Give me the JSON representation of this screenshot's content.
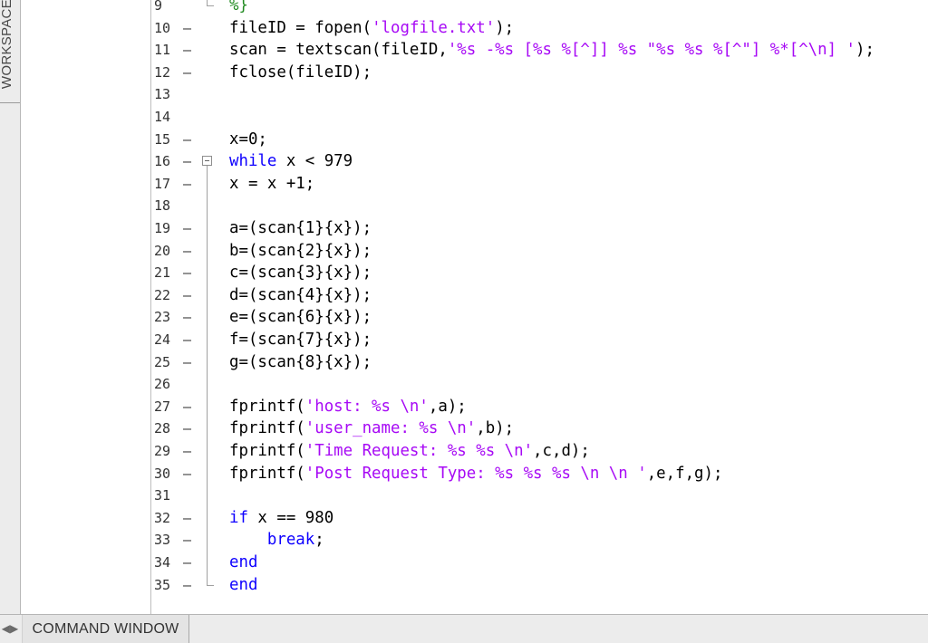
{
  "workspace": {
    "label": "WORKSPACE"
  },
  "command_window": {
    "label": "COMMAND WINDOW",
    "toggle_glyph": "◀▶"
  },
  "editor": {
    "lines": [
      {
        "n": "9",
        "dash": "",
        "segs": [
          {
            "t": "%}",
            "c": "cm"
          }
        ]
      },
      {
        "n": "10",
        "dash": "–",
        "segs": [
          {
            "t": "fileID = fopen(",
            "c": ""
          },
          {
            "t": "'logfile.txt'",
            "c": "str"
          },
          {
            "t": ");",
            "c": ""
          }
        ]
      },
      {
        "n": "11",
        "dash": "–",
        "segs": [
          {
            "t": "scan = textscan(fileID,",
            "c": ""
          },
          {
            "t": "'%s -%s [%s %[^]] %s \"%s %s %[^\"] %*[^\\n] '",
            "c": "str"
          },
          {
            "t": ");",
            "c": ""
          }
        ]
      },
      {
        "n": "12",
        "dash": "–",
        "segs": [
          {
            "t": "fclose(fileID);",
            "c": ""
          }
        ]
      },
      {
        "n": "13",
        "dash": "",
        "segs": []
      },
      {
        "n": "14",
        "dash": "",
        "segs": []
      },
      {
        "n": "15",
        "dash": "–",
        "segs": [
          {
            "t": "x=0;",
            "c": ""
          }
        ]
      },
      {
        "n": "16",
        "dash": "–",
        "segs": [
          {
            "t": "while",
            "c": "kw"
          },
          {
            "t": " x < 979",
            "c": ""
          }
        ]
      },
      {
        "n": "17",
        "dash": "–",
        "segs": [
          {
            "t": "x = x +1;",
            "c": ""
          }
        ]
      },
      {
        "n": "18",
        "dash": "",
        "segs": []
      },
      {
        "n": "19",
        "dash": "–",
        "segs": [
          {
            "t": "a=(scan{1}{x});",
            "c": ""
          }
        ]
      },
      {
        "n": "20",
        "dash": "–",
        "segs": [
          {
            "t": "b=(scan{2}{x});",
            "c": ""
          }
        ]
      },
      {
        "n": "21",
        "dash": "–",
        "segs": [
          {
            "t": "c=(scan{3}{x});",
            "c": ""
          }
        ]
      },
      {
        "n": "22",
        "dash": "–",
        "segs": [
          {
            "t": "d=(scan{4}{x});",
            "c": ""
          }
        ]
      },
      {
        "n": "23",
        "dash": "–",
        "segs": [
          {
            "t": "e=(scan{6}{x});",
            "c": ""
          }
        ]
      },
      {
        "n": "24",
        "dash": "–",
        "segs": [
          {
            "t": "f=(scan{7}{x});",
            "c": ""
          }
        ]
      },
      {
        "n": "25",
        "dash": "–",
        "segs": [
          {
            "t": "g=(scan{8}{x});",
            "c": ""
          }
        ]
      },
      {
        "n": "26",
        "dash": "",
        "segs": []
      },
      {
        "n": "27",
        "dash": "–",
        "segs": [
          {
            "t": "fprintf(",
            "c": ""
          },
          {
            "t": "'host: %s \\n'",
            "c": "str"
          },
          {
            "t": ",a);",
            "c": ""
          }
        ]
      },
      {
        "n": "28",
        "dash": "–",
        "segs": [
          {
            "t": "fprintf(",
            "c": ""
          },
          {
            "t": "'user_name: %s \\n'",
            "c": "str"
          },
          {
            "t": ",b);",
            "c": ""
          }
        ]
      },
      {
        "n": "29",
        "dash": "–",
        "segs": [
          {
            "t": "fprintf(",
            "c": ""
          },
          {
            "t": "'Time Request: %s %s \\n'",
            "c": "str"
          },
          {
            "t": ",c,d);",
            "c": ""
          }
        ]
      },
      {
        "n": "30",
        "dash": "–",
        "segs": [
          {
            "t": "fprintf(",
            "c": ""
          },
          {
            "t": "'Post Request Type: %s %s %s \\n \\n '",
            "c": "str"
          },
          {
            "t": ",e,f,g);",
            "c": ""
          }
        ]
      },
      {
        "n": "31",
        "dash": "",
        "segs": []
      },
      {
        "n": "32",
        "dash": "–",
        "segs": [
          {
            "t": "if",
            "c": "kw"
          },
          {
            "t": " x == 980",
            "c": ""
          }
        ]
      },
      {
        "n": "33",
        "dash": "–",
        "segs": [
          {
            "t": "    ",
            "c": ""
          },
          {
            "t": "break",
            "c": "kw"
          },
          {
            "t": ";",
            "c": ""
          }
        ]
      },
      {
        "n": "34",
        "dash": "–",
        "segs": [
          {
            "t": "end",
            "c": "kw"
          }
        ]
      },
      {
        "n": "35",
        "dash": "–",
        "segs": [
          {
            "t": "end",
            "c": "kw"
          }
        ]
      }
    ]
  },
  "colors": {
    "keyword": "#0e00ff",
    "string": "#a709f5",
    "comment": "#228b22"
  }
}
